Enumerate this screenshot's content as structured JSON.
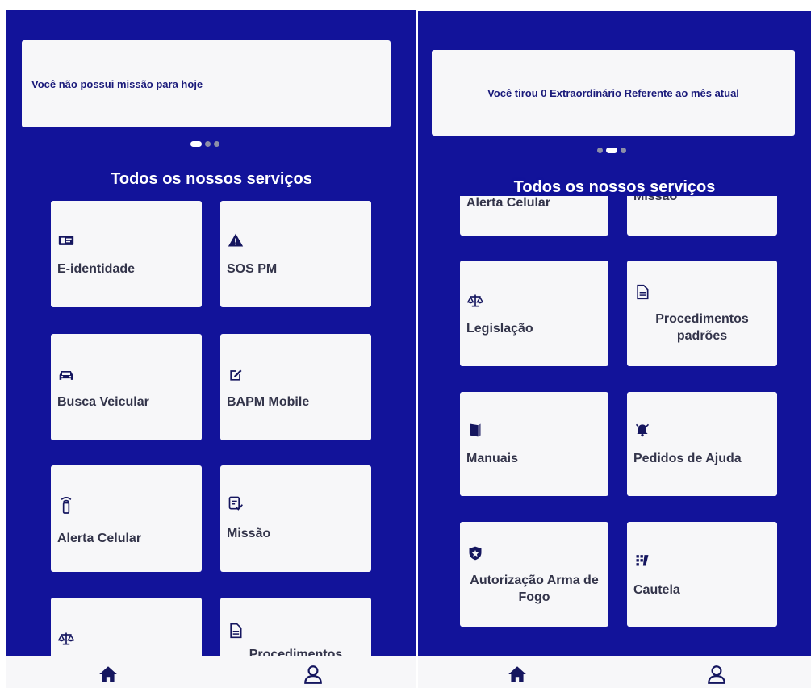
{
  "left": {
    "banner": "Você não possui missão para hoje",
    "section_title": "Todos os nossos serviços",
    "cards": [
      {
        "label": "E-identidade",
        "icon": "id-card-icon"
      },
      {
        "label": "SOS PM",
        "icon": "warning-icon"
      },
      {
        "label": "Busca Veicular",
        "icon": "car-icon"
      },
      {
        "label": "BAPM Mobile",
        "icon": "edit-icon"
      },
      {
        "label": "Alerta Celular",
        "icon": "phone-signal-icon"
      },
      {
        "label": "Missão",
        "icon": "checklist-icon"
      },
      {
        "label": "",
        "icon": "scales-icon"
      },
      {
        "label": "Procedimentos",
        "icon": "document-icon"
      }
    ],
    "carousel_active": 1
  },
  "right": {
    "banner": "Você tirou 0 Extraordinário Referente ao mês atual",
    "section_title": "Todos os nossos serviços",
    "cards": [
      {
        "label": "Alerta Celular",
        "icon": "phone-signal-icon"
      },
      {
        "label": "Missão",
        "icon": "checklist-icon"
      },
      {
        "label": "Legislação",
        "icon": "scales-icon"
      },
      {
        "label": "Procedimentos padrões",
        "icon": "document-icon"
      },
      {
        "label": "Manuais",
        "icon": "book-icon"
      },
      {
        "label": "Pedidos de Ajuda",
        "icon": "bell-alert-icon"
      },
      {
        "label": "Autorização Arma de Fogo",
        "icon": "shield-star-icon"
      },
      {
        "label": "Cautela",
        "icon": "tally-icon"
      }
    ],
    "carousel_active": 2
  },
  "tabbar": {
    "tabs": [
      {
        "name": "home",
        "icon": "home-icon",
        "selected": true
      },
      {
        "name": "profile",
        "icon": "user-icon",
        "selected": false
      }
    ]
  },
  "colors": {
    "background": "#12139a",
    "card": "#f7f7f9",
    "icon": "#15165f",
    "text": "#33344a"
  }
}
